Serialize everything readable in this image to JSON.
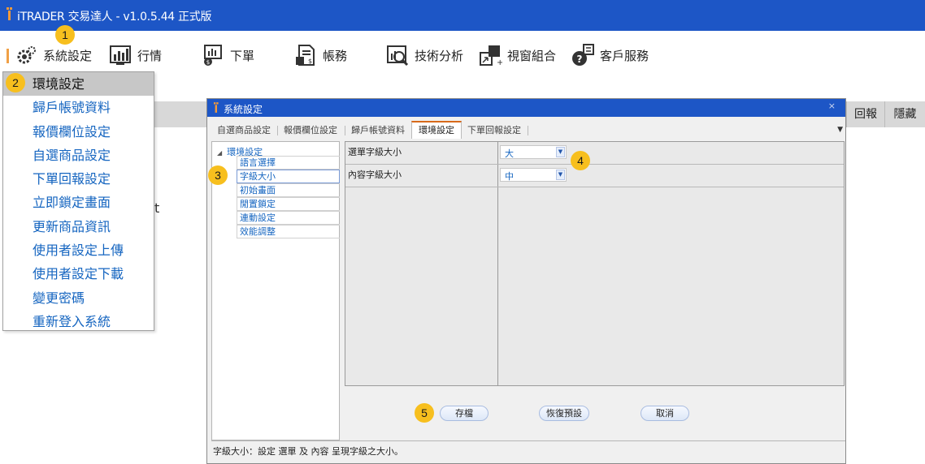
{
  "app": {
    "title": "iTRADER 交易達人 - v1.0.5.44 正式版"
  },
  "menubar": {
    "items": [
      {
        "label": "系統設定",
        "icon": "gear-icon"
      },
      {
        "label": "行情",
        "icon": "chart-icon"
      },
      {
        "label": "下單",
        "icon": "order-icon"
      },
      {
        "label": "帳務",
        "icon": "account-icon"
      },
      {
        "label": "技術分析",
        "icon": "analysis-icon"
      },
      {
        "label": "視窗組合",
        "icon": "window-icon"
      },
      {
        "label": "客戶服務",
        "icon": "service-icon"
      }
    ]
  },
  "dropdown": {
    "items": [
      "環境設定",
      "歸戶帳號資料",
      "報價欄位設定",
      "自選商品設定",
      "下單回報設定",
      "立即鎖定畫面",
      "更新商品資訊",
      "使用者設定上傳",
      "使用者設定下載",
      "變更密碼",
      "重新登入系統"
    ]
  },
  "background": {
    "buttons": [
      "回報",
      "隱藏"
    ],
    "stray_text": "t"
  },
  "dialog": {
    "title": "系統設定",
    "close": "×",
    "tabs": [
      "自選商品設定",
      "報價欄位設定",
      "歸戶帳號資料",
      "環境設定",
      "下單回報設定"
    ],
    "active_tab": "環境設定",
    "tree": {
      "root": "環境設定",
      "children": [
        "語言選擇",
        "字級大小",
        "初始畫面",
        "閒置鎖定",
        "連動設定",
        "效能調整"
      ],
      "selected": "字級大小"
    },
    "grid": {
      "rows": [
        {
          "key": "選單字級大小",
          "value": "大"
        },
        {
          "key": "內容字級大小",
          "value": "中"
        }
      ]
    },
    "buttons": {
      "save": "存檔",
      "restore": "恢復預設",
      "cancel": "取消"
    },
    "status": "字級大小：設定 選單 及 內容 呈現字級之大小。"
  },
  "badges": [
    "1",
    "2",
    "3",
    "4",
    "5"
  ],
  "colors": {
    "titlebar": "#1d56c6",
    "badge": "#f7bf1e",
    "link_blue": "#1565c0",
    "active_tab_accent": "#d86a1a"
  }
}
